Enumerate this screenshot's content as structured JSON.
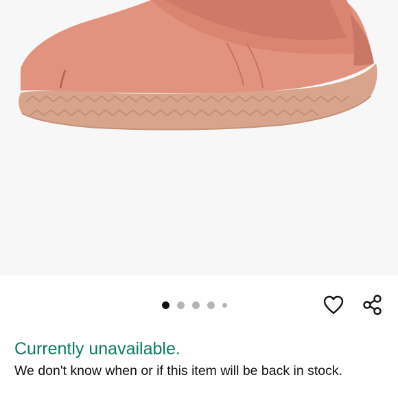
{
  "product_image": {
    "alt": "",
    "shoe_color": "#e2937f",
    "sole_color": "#d8a48c"
  },
  "carousel": {
    "total_dots": 5,
    "active_index": 0
  },
  "actions": {
    "wishlist_icon": "heart-icon",
    "share_icon": "share-icon"
  },
  "availability": {
    "status": "Currently unavailable.",
    "message": "We don't know when or if this item will be back in stock.",
    "status_color": "#0a7b62"
  }
}
